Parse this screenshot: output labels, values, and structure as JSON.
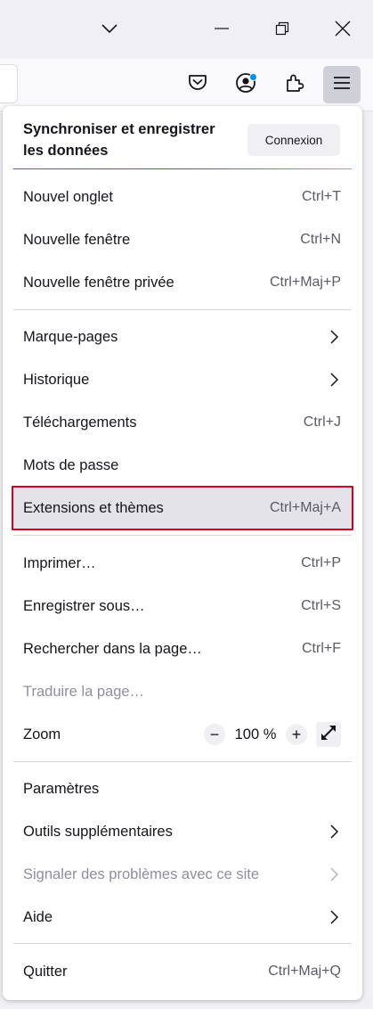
{
  "titlebar": {
    "icons": [
      "chevron-down-icon",
      "minimize-icon",
      "restore-icon",
      "close-icon"
    ]
  },
  "toolbar": {
    "icons": [
      "pocket-icon",
      "account-icon",
      "extensions-icon",
      "hamburger-menu-icon"
    ],
    "notification_color": "#0090ed"
  },
  "menu": {
    "sync": {
      "title": "Synchroniser et enregistrer les données",
      "button": "Connexion"
    },
    "items": {
      "new_tab": {
        "label": "Nouvel onglet",
        "shortcut": "Ctrl+T"
      },
      "new_window": {
        "label": "Nouvelle fenêtre",
        "shortcut": "Ctrl+N"
      },
      "private_window": {
        "label": "Nouvelle fenêtre privée",
        "shortcut": "Ctrl+Maj+P"
      },
      "bookmarks": {
        "label": "Marque-pages"
      },
      "history": {
        "label": "Historique"
      },
      "downloads": {
        "label": "Téléchargements",
        "shortcut": "Ctrl+J"
      },
      "passwords": {
        "label": "Mots de passe"
      },
      "addons": {
        "label": "Extensions et thèmes",
        "shortcut": "Ctrl+Maj+A"
      },
      "print": {
        "label": "Imprimer…",
        "shortcut": "Ctrl+P"
      },
      "save_as": {
        "label": "Enregistrer sous…",
        "shortcut": "Ctrl+S"
      },
      "find": {
        "label": "Rechercher dans la page…",
        "shortcut": "Ctrl+F"
      },
      "translate": {
        "label": "Traduire la page…"
      },
      "zoom": {
        "label": "Zoom",
        "minus": "−",
        "value": "100 %",
        "plus": "+"
      },
      "settings": {
        "label": "Paramètres"
      },
      "more_tools": {
        "label": "Outils supplémentaires"
      },
      "report": {
        "label": "Signaler des problèmes avec ce site"
      },
      "help": {
        "label": "Aide"
      },
      "quit": {
        "label": "Quitter",
        "shortcut": "Ctrl+Maj+Q"
      }
    },
    "highlight_color": "#d70022"
  }
}
